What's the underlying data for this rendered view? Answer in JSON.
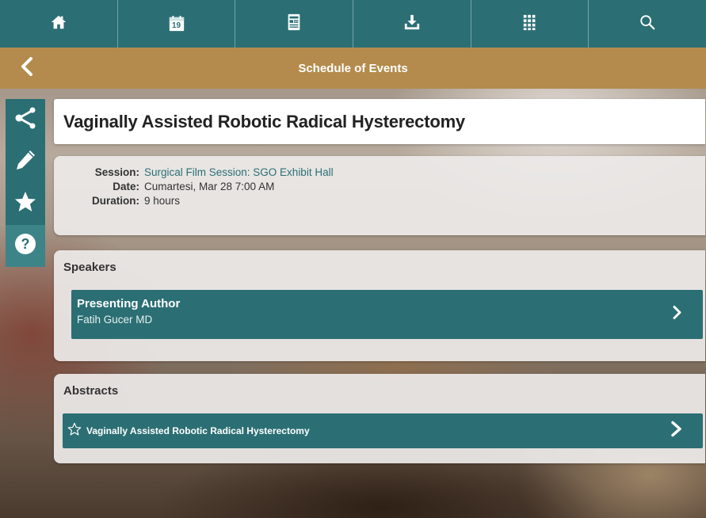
{
  "topnav": {
    "items": [
      {
        "icon": "home-icon"
      },
      {
        "icon": "calendar-icon",
        "label": "19"
      },
      {
        "icon": "schedule-icon"
      },
      {
        "icon": "download-icon"
      },
      {
        "icon": "grid-icon"
      },
      {
        "icon": "search-icon"
      }
    ]
  },
  "header": {
    "title": "Schedule of Events",
    "back_icon": "chevron-left-icon"
  },
  "sidebar": {
    "items": [
      {
        "icon": "share-icon"
      },
      {
        "icon": "pencil-icon"
      },
      {
        "icon": "star-icon"
      },
      {
        "icon": "help-icon"
      }
    ]
  },
  "event": {
    "title": "Vaginally Assisted Robotic Radical Hysterectomy",
    "session_label": "Session:",
    "session_value": "Surgical Film Session: SGO Exhibit Hall",
    "date_label": "Date:",
    "date_value": "Cumartesi, Mar 28 7:00 AM",
    "duration_label": "Duration:",
    "duration_value": "9 hours"
  },
  "speakers": {
    "heading": "Speakers",
    "items": [
      {
        "role": "Presenting Author",
        "name": "Fatih Gucer MD"
      }
    ]
  },
  "abstracts": {
    "heading": "Abstracts",
    "items": [
      {
        "title": "Vaginally Assisted Robotic Radical Hysterectomy"
      }
    ]
  },
  "colors": {
    "teal": "#2b6f74",
    "gold": "#b48b4c",
    "link": "#2b6f74"
  }
}
